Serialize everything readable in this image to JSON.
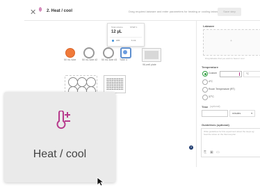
{
  "header": {
    "close_icon": "close-icon",
    "step_icon": "heat-cool-icon",
    "title": "2. Heat / cool",
    "hint": "Drag required labware and enter parameters for heating or cooling labware",
    "save_label": "Save step"
  },
  "popup": {
    "label_a": "Total volume",
    "label_b": "STEP 1",
    "value": "12 µL",
    "row_key": "A01",
    "row_val": "1 mL"
  },
  "labware": {
    "tubes": [
      {
        "label": "50 mL tube",
        "color": "#f07a3a"
      },
      {
        "label": "50 mL tube #2",
        "color": "#ffffff"
      },
      {
        "label": "50 mL tube #3",
        "color": "#ffffff"
      },
      {
        "label": "Tube 4",
        "color": "#6a9ce0"
      }
    ],
    "plate_label": "96-well plate",
    "rack_label": "Rack"
  },
  "panel": {
    "labware_heading": "Labware",
    "dropzone_caption": "Drag labware that you want to heat or cool",
    "temperature_heading": "Temperature",
    "opt_custom": "Custom",
    "unit": "°C",
    "opt_4": "4°C",
    "opt_rt": "Room Temperature (RT)",
    "opt_37": "37°C",
    "time_heading": "Time",
    "time_optional": "(optional)",
    "time_unit": "minutes",
    "guidelines_heading": "Guidelines (optional)",
    "guidelines_placeholder": "Write guidelines for this experiment about the steps eg: heat the tubes on the thermocycler"
  },
  "tile": {
    "label": "Heat / cool",
    "icon": "thermometer-plus-minus-icon",
    "accent": "#b73a8c"
  }
}
